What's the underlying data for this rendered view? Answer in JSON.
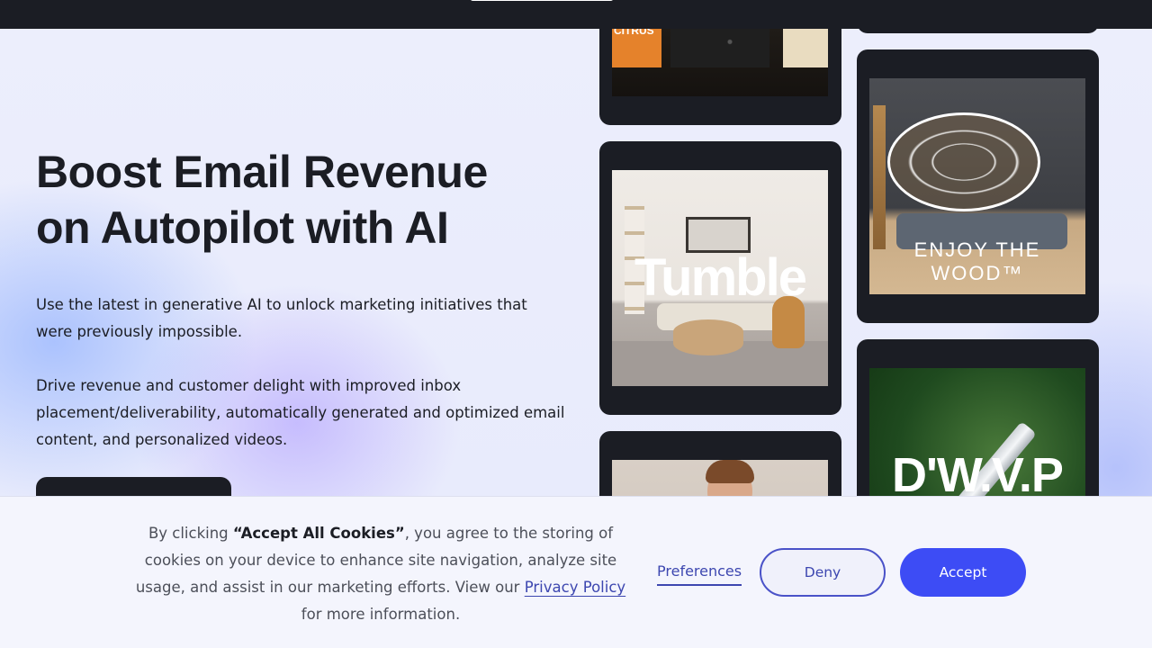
{
  "hero": {
    "title_line1": "Boost Email Revenue",
    "title_line2": "on Autopilot with AI",
    "paragraph1": "Use the latest in generative AI to unlock marketing initiatives that were previously impossible.",
    "paragraph2": "Drive revenue and customer delight with improved inbox placement/deliverability, automatically generated and optimized email content, and personalized videos."
  },
  "gallery": {
    "citrus_label": "CITRUS",
    "tumble_logo": "Tumble",
    "wood_logo": "ENJOY THE WOOD™",
    "dwvp_logo": "D'W.V.P"
  },
  "cookie_banner": {
    "text_prefix": "By clicking ",
    "text_bold": "“Accept All Cookies”",
    "text_middle": ", you agree to the storing of cookies on your device to enhance site navigation, analyze site usage, and assist in our marketing efforts. View our ",
    "privacy_link": "Privacy Policy",
    "text_suffix": " for more information.",
    "preferences_label": "Preferences",
    "deny_label": "Deny",
    "accept_label": "Accept"
  },
  "colors": {
    "dark": "#1b1d24",
    "accent": "#3d4cf5",
    "link": "#3d47b0"
  }
}
